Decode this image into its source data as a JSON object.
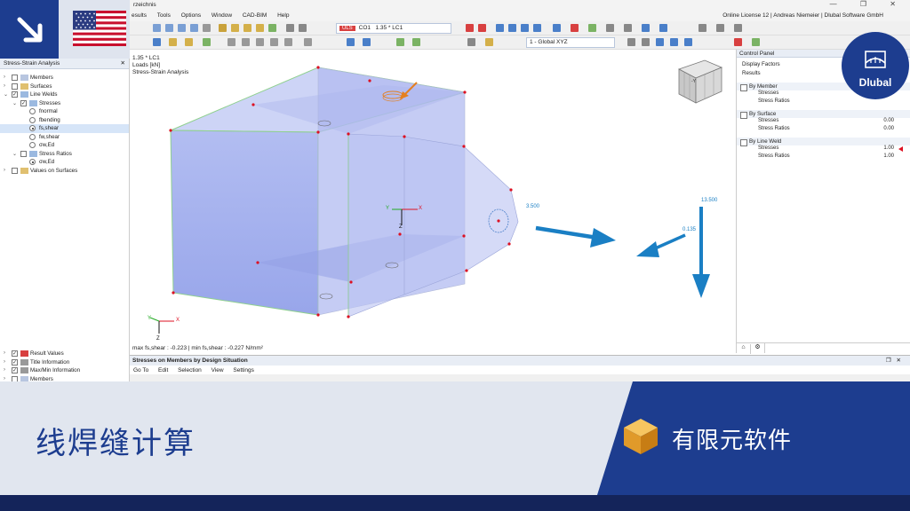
{
  "titlebar": {
    "document": "rzeichnis",
    "controls": "— ❐ ✕"
  },
  "menubar": {
    "items": [
      "esults",
      "Tools",
      "Options",
      "Window",
      "CAD-BIM",
      "Help"
    ],
    "license": "Online License 12 | Andreas Niemeier | Dlubal Software GmbH"
  },
  "toolbar": {
    "loadcase_tag": "ULS",
    "loadcase_code": "CO1",
    "loadcase_combo": "1.35 * LC1",
    "coord_system": "1 - Global XYZ"
  },
  "navigator": {
    "title": "Stress-Strain Analysis",
    "items": [
      {
        "label": "Members"
      },
      {
        "label": "Surfaces"
      },
      {
        "label": "Line Welds"
      },
      {
        "label": "Stresses"
      },
      {
        "label": "fnormal"
      },
      {
        "label": "fbending"
      },
      {
        "label": "fs,shear"
      },
      {
        "label": "fw,shear"
      },
      {
        "label": "σw,Ed"
      },
      {
        "label": "Stress Ratios"
      },
      {
        "label": "σw,Ed"
      },
      {
        "label": "Values on Surfaces"
      }
    ],
    "bottom_items": [
      {
        "label": "Result Values"
      },
      {
        "label": "Title Information"
      },
      {
        "label": "Max/Min Information"
      },
      {
        "label": "Members"
      }
    ]
  },
  "viewport": {
    "info_line1": "1.35 * LC1",
    "info_line2": "Loads [kN]",
    "info_line3": "Stress-Strain Analysis",
    "max_min": "max fs,shear : -0.223 | min fs,shear : -0.227 N/mm²",
    "load_labels": [
      "3.500",
      "13.500",
      "0.135"
    ],
    "axes": {
      "x": "X",
      "y": "Y",
      "z": "Z"
    },
    "cube_label": "-Y"
  },
  "control_panel": {
    "title": "Control Panel",
    "sub1": "Display Factors",
    "sub2": "Results",
    "groups": [
      {
        "title": "By Member",
        "rows": [
          {
            "label": "Stresses",
            "value": ""
          },
          {
            "label": "Stress Ratios",
            "value": ""
          }
        ]
      },
      {
        "title": "By Surface",
        "rows": [
          {
            "label": "Stresses",
            "value": "0.00"
          },
          {
            "label": "Stress Ratios",
            "value": "0.00"
          }
        ]
      },
      {
        "title": "By Line Weld",
        "rows": [
          {
            "label": "Stresses",
            "value": "1.00"
          },
          {
            "label": "Stress Ratios",
            "value": "1.00"
          }
        ]
      }
    ]
  },
  "table_panel": {
    "title": "Stresses on Members by Design Situation",
    "menu": [
      "Go To",
      "Edit",
      "Selection",
      "View",
      "Settings"
    ]
  },
  "logo": {
    "name": "Dlubal"
  },
  "banner": {
    "title": "线焊缝计算",
    "category": "有限元软件"
  },
  "colors": {
    "brand_blue": "#1d3d8f",
    "dark_navy": "#14245a",
    "banner_bg": "#e1e6ef",
    "load_arrow": "#1a7fc4"
  }
}
